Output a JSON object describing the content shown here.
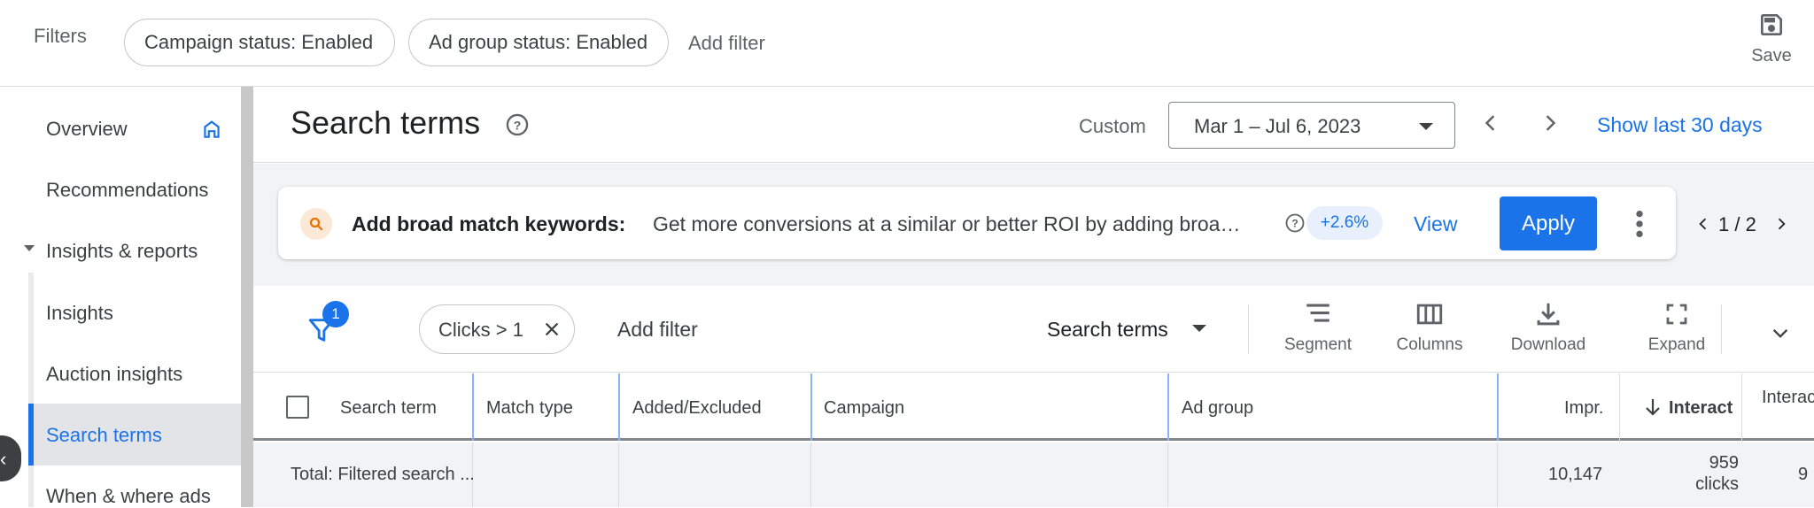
{
  "filters_bar": {
    "label": "Filters",
    "chips": [
      "Campaign status: Enabled",
      "Ad group status: Enabled"
    ],
    "add_filter": "Add filter",
    "save_label": "Save"
  },
  "sidebar": {
    "items": [
      {
        "label": "Overview"
      },
      {
        "label": "Recommendations"
      },
      {
        "label": "Insights & reports"
      },
      {
        "label": "Insights"
      },
      {
        "label": "Auction insights"
      },
      {
        "label": "Search terms",
        "active": true
      },
      {
        "label": "When & where ads"
      }
    ]
  },
  "header": {
    "title": "Search terms",
    "date_mode": "Custom",
    "date_range": "Mar 1 – Jul 6, 2023",
    "show_last": "Show last 30 days"
  },
  "recommendation": {
    "title": "Add broad match keywords:",
    "description": "Get more conversions at a similar or better ROI by adding broa…",
    "uplift": "+2.6%",
    "view_label": "View",
    "apply_label": "Apply",
    "pager": "1 / 2"
  },
  "toolbar": {
    "filter_count": "1",
    "filter_chip": "Clicks > 1",
    "add_filter": "Add filter",
    "level": "Search terms",
    "segment": "Segment",
    "columns": "Columns",
    "download": "Download",
    "expand": "Expand"
  },
  "table": {
    "headers": [
      "Search term",
      "Match type",
      "Added/Excluded",
      "Campaign",
      "Ad group",
      "Impr.",
      "Interact",
      "Interac"
    ],
    "total": {
      "label": "Total: Filtered search ...",
      "impr": "10,147",
      "interactions_value": "959",
      "interactions_unit": "clicks",
      "partial": "9"
    }
  },
  "colors": {
    "accent": "#1a73e8",
    "sidebar_active_bg": "#e2e4e8",
    "reco_area_bg": "#f1f3f4"
  }
}
